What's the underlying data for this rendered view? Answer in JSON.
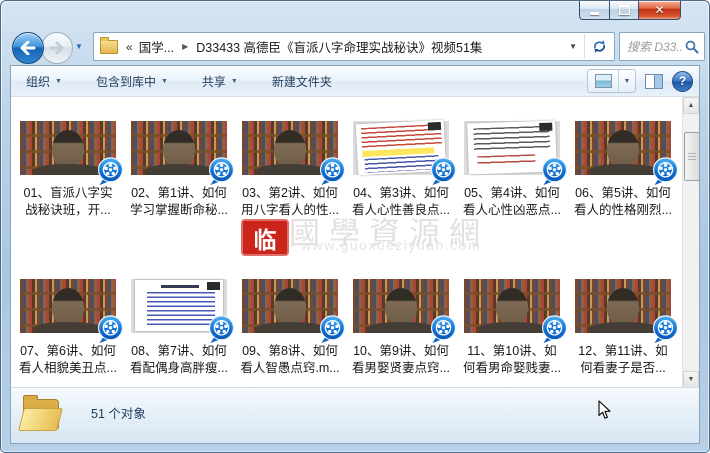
{
  "icons": {
    "dropdown_caret": "▼",
    "breadcrumb_overflow": "«",
    "breadcrumb_separator": "▶",
    "scroll_up": "▲",
    "scroll_down": "▼",
    "help": "?",
    "close": "✕"
  },
  "navbar": {
    "breadcrumb_root": "国学...",
    "breadcrumb_current": "D33433 高德臣《盲派八字命理实战秘诀》视频51集",
    "search_placeholder": "搜索 D33..."
  },
  "toolbar": {
    "organize": "组织",
    "include_in_library": "包含到库中",
    "share": "共享",
    "new_folder": "新建文件夹"
  },
  "files": {
    "items": [
      {
        "line1": "01、盲派八字实",
        "line2": "战秘诀班，开...",
        "thumb": "presenter"
      },
      {
        "line1": "02、第1讲、如何",
        "line2": "学习掌握断命秘...",
        "thumb": "presenter"
      },
      {
        "line1": "03、第2讲、如何",
        "line2": "用八字看人的性...",
        "thumb": "presenter"
      },
      {
        "line1": "04、第3讲、如何",
        "line2": "看人心性善良点...",
        "thumb": "slide-red"
      },
      {
        "line1": "05、第4讲、如何",
        "line2": "看人心性凶恶点...",
        "thumb": "slide-plain"
      },
      {
        "line1": "06、第5讲、如何",
        "line2": "看人的性格刚烈...",
        "thumb": "presenter"
      },
      {
        "line1": "07、第6讲、如何",
        "line2": "看人相貌美丑点...",
        "thumb": "presenter"
      },
      {
        "line1": "08、第7讲、如何",
        "line2": "看配偶身高胖瘦...",
        "thumb": "slide-blue"
      },
      {
        "line1": "09、第8讲、如何",
        "line2": "看人智愚点窍.m...",
        "thumb": "presenter"
      },
      {
        "line1": "10、第9讲、如何",
        "line2": "看男娶贤妻点窍...",
        "thumb": "presenter"
      },
      {
        "line1": "11、第10讲、如",
        "line2": "何看男命娶贱妻...",
        "thumb": "presenter"
      },
      {
        "line1": "12、第11讲、如",
        "line2": "何看妻子是否...",
        "thumb": "presenter"
      }
    ]
  },
  "watermark": {
    "seal": "临",
    "site_name": "國學資源網",
    "site_url": "www.guoxueziyuan.com"
  },
  "details_pane": {
    "item_count": "51 个对象"
  }
}
